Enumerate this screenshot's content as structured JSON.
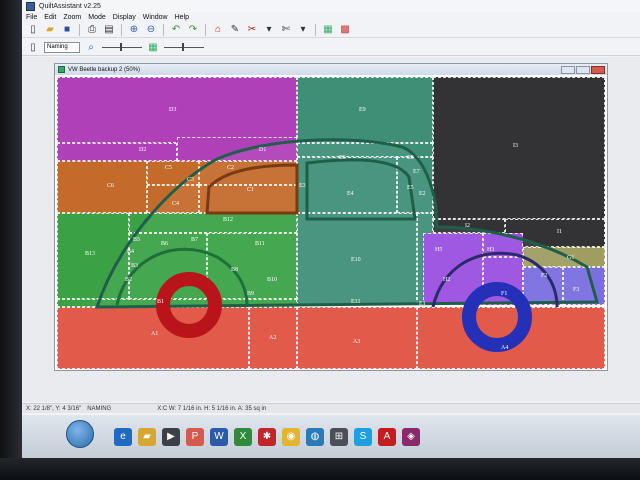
{
  "app": {
    "title": "QuiltAssistant v2.25"
  },
  "menu": {
    "items": [
      "File",
      "Edit",
      "Zoom",
      "Mode",
      "Display",
      "Window",
      "Help"
    ]
  },
  "toolbar2": {
    "select_value": "Naming"
  },
  "child_window": {
    "title": "VW Beetle backup 2 (50%)"
  },
  "patches": {
    "D3": "D3",
    "D2": "D2",
    "D1": "D1",
    "E9": "E9",
    "E6": "E6",
    "E8": "E8",
    "E7": "E7",
    "E4": "E4",
    "E5": "E5",
    "E2": "E2",
    "E3": "E3",
    "E10": "E10",
    "E11": "E11",
    "E1": "E1",
    "I3": "I3",
    "I2": "I2",
    "I1": "I1",
    "G1": "G1",
    "F2": "F2",
    "F3": "F3",
    "F1": "F1",
    "C5": "C5",
    "C2": "C2",
    "C6": "C6",
    "C3": "C3",
    "C1": "C1",
    "C4": "C4",
    "B12": "B12",
    "B13": "B13",
    "B11": "B11",
    "B7": "B7",
    "B6": "B6",
    "B8": "B8",
    "B10": "B10",
    "B9": "B9",
    "B1": "B1",
    "B2": "B2",
    "B3": "B3",
    "B4": "B4",
    "B5": "B5",
    "H5": "H5",
    "H3": "H3",
    "H2": "H2",
    "A1": "A1",
    "A2": "A2",
    "A3": "A3",
    "A4": "A4"
  },
  "statusbar": {
    "coords": "X: 22 1/8\", Y: 4 3/16\"",
    "mode": "NAMING",
    "info": "X:C W: 7 1/16 in. H: 5 1/16 in. A: 35 sq in"
  },
  "colors": {
    "purple": "#b040b8",
    "teal": "#3f8f77",
    "charcoal": "#333336",
    "orange": "#c46a2a",
    "green": "#3aa244",
    "salmon": "#e15a4a",
    "violet": "#9a4ee0",
    "wheel_red": "#b8141a",
    "wheel_blue": "#2430b8"
  }
}
